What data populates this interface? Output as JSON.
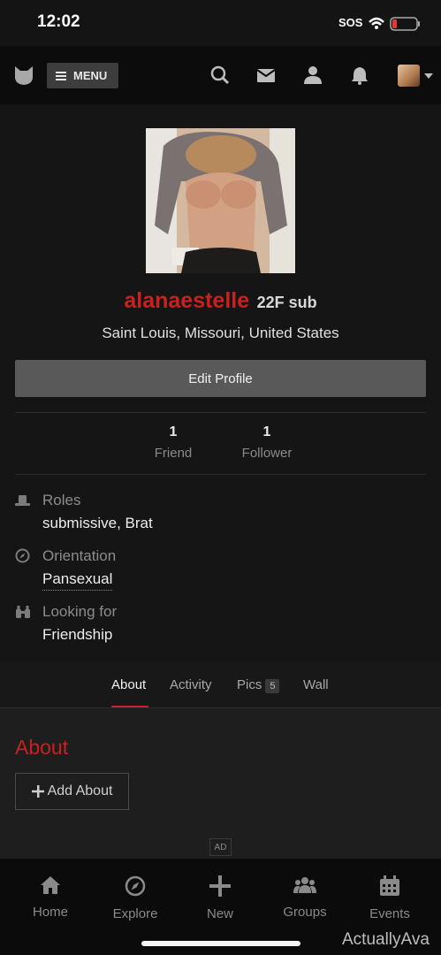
{
  "status_bar": {
    "time": "12:02",
    "sos": "SOS"
  },
  "navbar": {
    "menu_label": "MENU",
    "icons": [
      "logo-icon",
      "search-icon",
      "mail-icon",
      "user-icon",
      "bell-icon",
      "avatar",
      "chevron-down-icon"
    ]
  },
  "profile": {
    "username": "alanaestelle",
    "meta": "22F sub",
    "location": "Saint Louis, Missouri, United States",
    "edit_label": "Edit Profile",
    "stats": [
      {
        "value": "1",
        "label": "Friend"
      },
      {
        "value": "1",
        "label": "Follower"
      }
    ],
    "info": [
      {
        "label": "Roles",
        "value": "submissive, Brat",
        "icon": "hat-icon"
      },
      {
        "label": "Orientation",
        "value": "Pansexual",
        "icon": "compass-icon"
      },
      {
        "label": "Looking for",
        "value": "Friendship",
        "icon": "binoculars-icon"
      }
    ]
  },
  "tabs": {
    "items": [
      {
        "label": "About",
        "active": true
      },
      {
        "label": "Activity"
      },
      {
        "label": "Pics",
        "badge": "5"
      },
      {
        "label": "Wall"
      }
    ]
  },
  "about": {
    "title": "About",
    "add_label": "Add About",
    "ad_label": "AD"
  },
  "bottom_nav": {
    "items": [
      {
        "label": "Home",
        "icon": "home-icon"
      },
      {
        "label": "Explore",
        "icon": "compass-icon"
      },
      {
        "label": "New",
        "icon": "plus-icon"
      },
      {
        "label": "Groups",
        "icon": "groups-icon"
      },
      {
        "label": "Events",
        "icon": "calendar-icon"
      }
    ]
  },
  "watermark": "ActuallyAva",
  "colors": {
    "accent": "#cc1f1f",
    "background": "#141414",
    "button": "#595959"
  }
}
